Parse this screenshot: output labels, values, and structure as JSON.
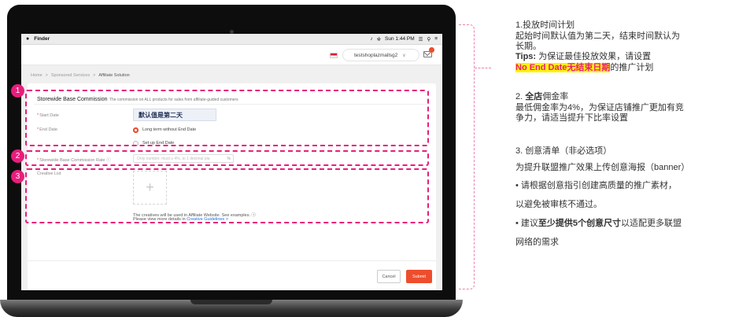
{
  "menubar": {
    "app": "Finder",
    "time": "Sun 1:44 PM"
  },
  "topbar": {
    "account": "testshoplazmallsg2"
  },
  "breadcrumb": [
    "Home",
    "Sponsored Services",
    "Affiliate Solution"
  ],
  "form": {
    "title": "Storewide Base Commission",
    "subtitle": "The commission on ALL products for sales from affiliate-guided customers",
    "start_label": "Start Date",
    "start_value": "默认值是第二天",
    "end_label": "End Date",
    "end_option_1": "Long term without End Date",
    "end_option_2": "Set up End Date",
    "end_selected": "Long term without End Date",
    "rate_label": "Storewide Base Commission Rate",
    "rate_placeholder": "Only number, must ≥ 4%, to 1 decimal pla",
    "rate_suffix": "%",
    "creative_label": "Creative List",
    "creative_note": "The creatives will be used in Affiliate Website. See examples.",
    "creative_link_prefix": "Please view more details in",
    "creative_link": "Creative Guidelines >",
    "cancel": "Cancel",
    "submit": "Submit"
  },
  "badges": [
    "1",
    "2",
    "3"
  ],
  "notes": {
    "n1_title": "1.投放时间计划",
    "n1_l1": "起始时间默认值为第二天，结束时间默认为",
    "n1_l2": "长期。",
    "n1_tips": "Tips:",
    "n1_l3": " 为保证最佳投放效果，请设置",
    "n1_highlight": "No End Date无结束日期",
    "n1_l4": "的推广计划",
    "n2_num": "2. ",
    "n2_bold": "全店",
    "n2_rest": "佣金率",
    "n2_l1": "最低佣金率为4%，为保证店铺推广更加有竞",
    "n2_l2": "争力，请适当提升下比率设置",
    "n3_title": "3. 创意清单（非必选项）",
    "n3_l1": "为提升联盟推广效果上传创意海报（banner）",
    "n3_l2": "• 请根据创意指引创建高质量的推广素材，",
    "n3_l3": "以避免被审核不通过。",
    "n3_l4_pre": "• 建议",
    "n3_l4_bold": "至少提供5个创意尺寸",
    "n3_l4_post": "以适配更多联盟",
    "n3_l5": "网络的需求"
  },
  "colors": {
    "accent": "#ee4d2d",
    "annotation": "#e81d7b",
    "highlight": "#fff200"
  }
}
